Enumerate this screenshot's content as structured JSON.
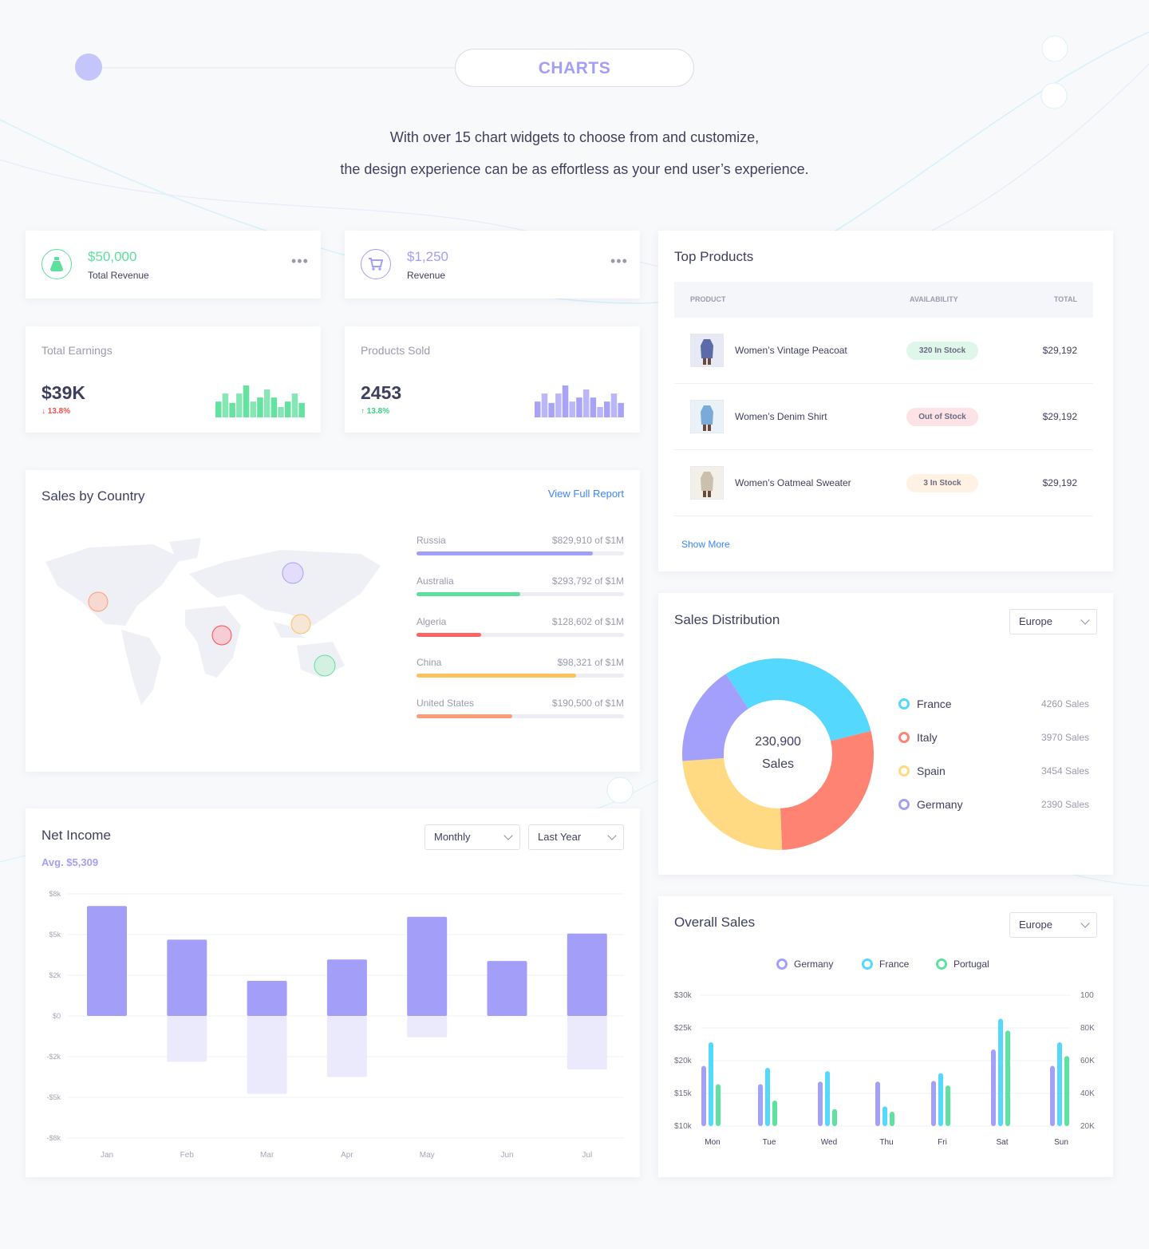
{
  "header": {
    "title": "CHARTS",
    "intro_line1": "With over 15 chart widgets to choose from and customize,",
    "intro_line2": "the design experience can be as effortless as your end user’s experience."
  },
  "stats": [
    {
      "value": "$50,000",
      "label": "Total Revenue",
      "icon": "money-bag-icon",
      "color": "#5ce09b"
    },
    {
      "value": "$1,250",
      "label": "Revenue",
      "icon": "shopping-cart-icon",
      "color": "#a39ef7"
    }
  ],
  "earnings": {
    "title": "Total Earnings",
    "value": "$39K",
    "change": "13.8%",
    "direction": "down",
    "color": "#5ce09b",
    "bars": [
      59,
      89,
      54,
      89,
      119,
      59,
      74,
      104,
      74,
      39,
      59,
      89,
      54
    ]
  },
  "sold": {
    "title": "Products Sold",
    "value": "2453",
    "change": "13.8%",
    "direction": "up",
    "color": "#a39ef7",
    "bars": [
      59,
      89,
      54,
      89,
      119,
      59,
      74,
      104,
      74,
      39,
      59,
      89,
      54
    ]
  },
  "country": {
    "title": "Sales by Country",
    "link": "View Full Report",
    "items": [
      {
        "name": "Russia",
        "amount": "$829,910 of $1M",
        "pct": 85,
        "color": "#a39ef7"
      },
      {
        "name": "Australia",
        "amount": "$293,792 of $1M",
        "pct": 50,
        "color": "#5ce09b"
      },
      {
        "name": "Algeria",
        "amount": "$128,602 of $1M",
        "pct": 31,
        "color": "#ff6464"
      },
      {
        "name": "China",
        "amount": "$98,321 of $1M",
        "pct": 77,
        "color": "#ffc060"
      },
      {
        "name": "United States",
        "amount": "$190,500 of $1M",
        "pct": 46,
        "color": "#ff9c73"
      }
    ]
  },
  "products": {
    "title": "Top Products",
    "columns": [
      "PRODUCT",
      "AVAILABILITY",
      "TOTAL"
    ],
    "show_more": "Show More",
    "rows": [
      {
        "name": "Women’s Vintage Peacoat",
        "availability": "320 In Stock",
        "status_color": "#dff7ea",
        "total": "$29,192"
      },
      {
        "name": "Women’s Denim Shirt",
        "availability": "Out of Stock",
        "status_color": "#fde2e6",
        "total": "$29,192"
      },
      {
        "name": "Women’s Oatmeal Sweater",
        "availability": "3 In Stock",
        "status_color": "#fff1e3",
        "total": "$29,192"
      }
    ]
  },
  "distribution": {
    "title": "Sales Distribution",
    "region": "Europe",
    "total": "230,900",
    "total_label": "Sales"
  },
  "net_income": {
    "title": "Net Income",
    "avg": "Avg. $5,309",
    "period": "Monthly",
    "range": "Last Year"
  },
  "overall": {
    "title": "Overall Sales",
    "region": "Europe"
  },
  "chart_data": [
    {
      "type": "bar",
      "title": "Net Income",
      "categories": [
        "Jan",
        "Feb",
        "Mar",
        "Apr",
        "May",
        "Jun",
        "Jul"
      ],
      "series": [
        {
          "values": [
            7.2,
            5.0,
            2.3,
            3.7,
            6.5,
            3.6,
            5.4
          ],
          "color": "#a39ef7"
        },
        {
          "values": [
            0,
            -3.0,
            -5.1,
            -4.0,
            -1.4,
            0,
            -3.5
          ],
          "color": "#ebeafd"
        }
      ],
      "y_ticks": [
        "$8k",
        "$5k",
        "$2k",
        "$0",
        "-$2k",
        "-$5k",
        "-$8k"
      ],
      "ylim": [
        -8,
        8
      ],
      "unit": "$k",
      "grid": true
    },
    {
      "type": "pie",
      "title": "Sales Distribution",
      "labels": [
        "France",
        "Italy",
        "Spain",
        "Germany"
      ],
      "values": [
        4260,
        3970,
        3454,
        2390
      ],
      "value_labels": [
        "4260 Sales",
        "3970 Sales",
        "3454 Sales",
        "2390 Sales"
      ],
      "colors": [
        "#55d8fe",
        "#ff8373",
        "#ffda83",
        "#a3a0fb"
      ]
    },
    {
      "type": "bar",
      "title": "Overall Sales",
      "categories": [
        "Mon",
        "Tue",
        "Wed",
        "Thu",
        "Fri",
        "Sat",
        "Sun"
      ],
      "series": [
        {
          "name": "Germany",
          "color": "#a3a0fb",
          "values": [
            19.2,
            16.4,
            16.8,
            16.8,
            16.9,
            21.7,
            19.2
          ]
        },
        {
          "name": "France",
          "color": "#55d8fe",
          "values": [
            22.8,
            18.9,
            18.4,
            13.0,
            18.1,
            26.4,
            22.8
          ]
        },
        {
          "name": "Portugal",
          "color": "#5ee2a0",
          "values": [
            16.4,
            13.9,
            12.6,
            12.2,
            16.2,
            24.6,
            20.7
          ]
        }
      ],
      "y_ticks": [
        "$30k",
        "$25k",
        "$20k",
        "$15k",
        "$10k"
      ],
      "y2_ticks": [
        "100",
        "80K",
        "60K",
        "40K",
        "20K"
      ],
      "ylim": [
        10,
        30
      ],
      "unit": "$k",
      "grid": true,
      "legend": "top"
    }
  ]
}
